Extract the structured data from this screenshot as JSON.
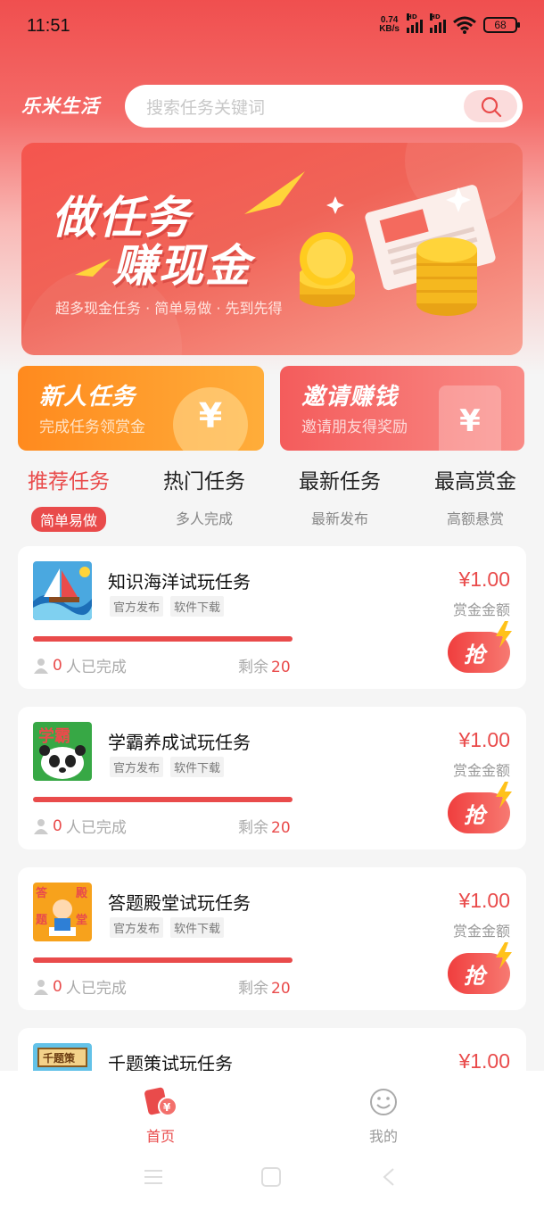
{
  "status": {
    "time": "11:51",
    "net_speed_top": "0.74",
    "net_speed_unit": "KB/s",
    "signal_label": "HD",
    "battery": "68"
  },
  "header": {
    "logo": "乐米生活",
    "search_placeholder": "搜索任务关键词"
  },
  "banner": {
    "line1": "做任务",
    "line2": "赚现金",
    "subtitle": "超多现金任务 · 简单易做 · 先到先得"
  },
  "promos": [
    {
      "title": "新人任务",
      "subtitle": "完成任务领赏金",
      "icon_glyph": "¥"
    },
    {
      "title": "邀请赚钱",
      "subtitle": "邀请朋友得奖励",
      "icon_glyph": "¥"
    }
  ],
  "tabs": [
    {
      "title": "推荐任务",
      "subtitle": "简单易做"
    },
    {
      "title": "热门任务",
      "subtitle": "多人完成"
    },
    {
      "title": "最新任务",
      "subtitle": "最新发布"
    },
    {
      "title": "最高赏金",
      "subtitle": "高额悬赏"
    }
  ],
  "tasks": [
    {
      "title": "知识海洋试玩任务",
      "tags": [
        "官方发布",
        "软件下载"
      ],
      "price": "¥1.00",
      "price_label": "赏金金额",
      "done_count": "0",
      "done_text": "人已完成",
      "remain_label": "剩余",
      "remain_count": "20",
      "grab_label": "抢",
      "progress": 1.0,
      "icon_text": ""
    },
    {
      "title": "学霸养成试玩任务",
      "tags": [
        "官方发布",
        "软件下载"
      ],
      "price": "¥1.00",
      "price_label": "赏金金额",
      "done_count": "0",
      "done_text": "人已完成",
      "remain_label": "剩余",
      "remain_count": "20",
      "grab_label": "抢",
      "progress": 1.0,
      "icon_text": "学霸"
    },
    {
      "title": "答题殿堂试玩任务",
      "tags": [
        "官方发布",
        "软件下载"
      ],
      "price": "¥1.00",
      "price_label": "赏金金额",
      "done_count": "0",
      "done_text": "人已完成",
      "remain_label": "剩余",
      "remain_count": "20",
      "grab_label": "抢",
      "progress": 1.0,
      "icon_text": "答题殿堂"
    },
    {
      "title": "千题策试玩任务",
      "price": "¥1.00",
      "icon_text": "千题策"
    }
  ],
  "bottom_nav": {
    "home_label": "首页",
    "me_label": "我的"
  },
  "colors": {
    "accent": "#e94b4b",
    "promo_orange": "#ff8a1e",
    "header_red": "#f04f4f"
  }
}
